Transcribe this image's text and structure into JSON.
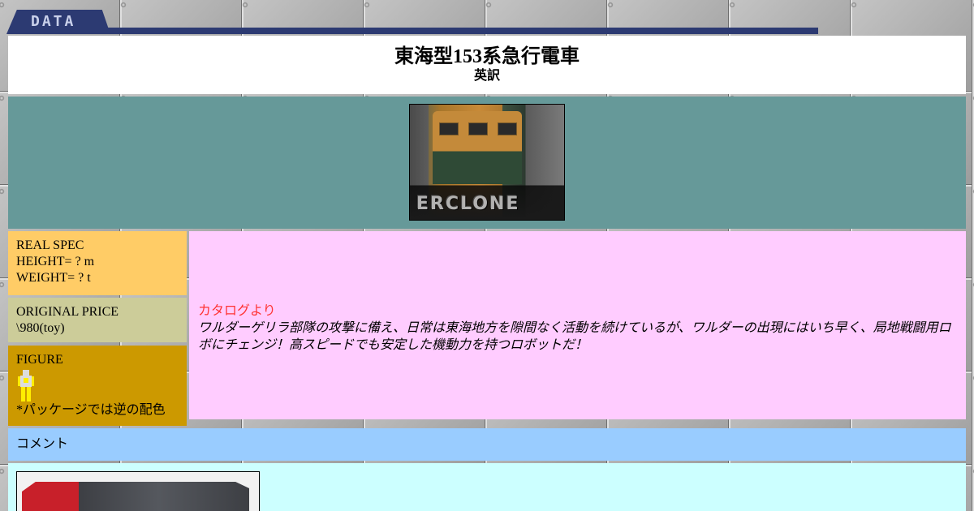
{
  "header": {
    "tab_label": "DATA"
  },
  "title": {
    "main": "東海型153系急行電車",
    "sub": "英訳"
  },
  "photo": {
    "icon": "train-photo",
    "logo_text": "ERCLONE"
  },
  "spec": {
    "real": {
      "heading": "REAL SPEC",
      "height": "HEIGHT= ? m",
      "weight": "WEIGHT= ? t"
    },
    "price": {
      "heading": "ORIGINAL PRICE",
      "value": "\\980(toy)"
    },
    "figure": {
      "heading": "FIGURE",
      "icon": "robot-figure-icon",
      "note": "*パッケージでは逆の配色"
    }
  },
  "catalog": {
    "heading": "カタログより",
    "text": "ワルダーゲリラ部隊の攻撃に備え、日常は東海地方を隙間なく活動を続けているが、ワルダーの出現にはいち早く、局地戦闘用ロボにチェンジ！高スピードでも安定した機動力を持つロボットだ！"
  },
  "comment": {
    "label": "コメント",
    "image_icon": "toy-photo"
  },
  "colors": {
    "tab": "#2c3a72",
    "photo_row": "#669999",
    "real_spec": "#ffcc66",
    "price": "#cccc99",
    "figure": "#cc9900",
    "catalog": "#ffccff",
    "catalog_heading": "#ff3333",
    "comment_label": "#99ccff",
    "comment_body": "#ccffff"
  }
}
